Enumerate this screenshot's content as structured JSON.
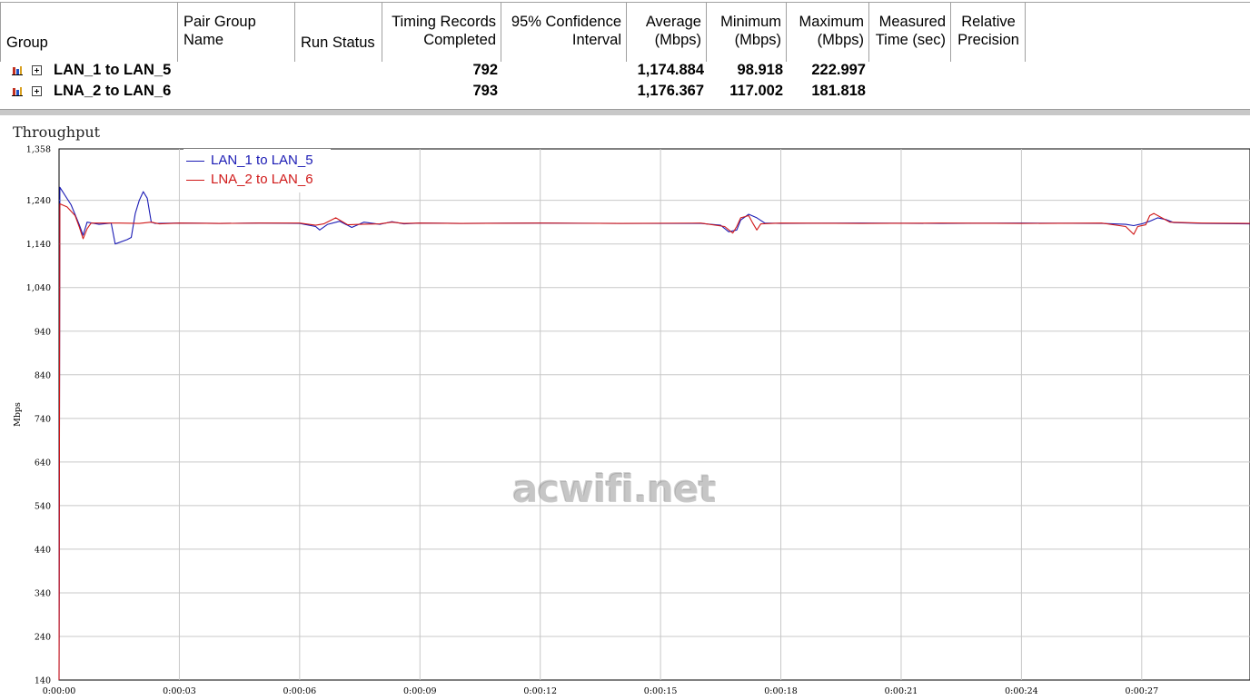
{
  "table": {
    "columns": [
      {
        "id": "group",
        "label_lines": [
          "Group"
        ]
      },
      {
        "id": "pair_group_name",
        "label_lines": [
          "Pair Group",
          "Name"
        ]
      },
      {
        "id": "run_status",
        "label_lines": [
          "Run Status"
        ]
      },
      {
        "id": "timing_records",
        "label_lines": [
          "Timing Records",
          "Completed"
        ]
      },
      {
        "id": "confidence",
        "label_lines": [
          "95% Confidence",
          "Interval"
        ]
      },
      {
        "id": "average",
        "label_lines": [
          "Average",
          "(Mbps)"
        ]
      },
      {
        "id": "minimum",
        "label_lines": [
          "Minimum",
          "(Mbps)"
        ]
      },
      {
        "id": "maximum",
        "label_lines": [
          "Maximum",
          "(Mbps)"
        ]
      },
      {
        "id": "measured_time",
        "label_lines": [
          "Measured",
          "Time (sec)"
        ]
      },
      {
        "id": "relative_precision",
        "label_lines": [
          "Relative",
          "Precision"
        ]
      }
    ],
    "rows": [
      {
        "group": "LAN_1 to LAN_5",
        "timing_records": "792",
        "average": "1,174.884",
        "minimum": "98.918",
        "maximum": "222.997"
      },
      {
        "group": "LNA_2 to LAN_6",
        "timing_records": "793",
        "average": "1,176.367",
        "minimum": "117.002",
        "maximum": "181.818"
      }
    ],
    "icons": {
      "row_icon": "bar-chart-icon",
      "expand_icon": "expand-plus-icon"
    }
  },
  "watermark": "acwifi.net",
  "chart_data": {
    "type": "line",
    "title": "Throughput",
    "ylabel": "Mbps",
    "xlabel": "",
    "ylim": [
      140,
      1358
    ],
    "xlim": [
      0,
      29.7
    ],
    "y_ticks": [
      140,
      240,
      340,
      440,
      540,
      640,
      740,
      840,
      940,
      1040,
      1140,
      1240,
      1358
    ],
    "y_tick_labels": [
      "140",
      "240",
      "340",
      "440",
      "540",
      "640",
      "740",
      "840",
      "940",
      "1,040",
      "1,140",
      "1,240",
      "1,358"
    ],
    "x_ticks": [
      0,
      3,
      6,
      9,
      12,
      15,
      18,
      21,
      24,
      27
    ],
    "x_tick_labels": [
      "0:00:00",
      "0:00:03",
      "0:00:06",
      "0:00:09",
      "0:00:12",
      "0:00:15",
      "0:00:18",
      "0:00:21",
      "0:00:24",
      "0:00:27"
    ],
    "grid": true,
    "legend_position": "top-left",
    "series": [
      {
        "name": "LAN_1 to LAN_5",
        "color": "#1a1ab4",
        "points": [
          [
            0,
            140
          ],
          [
            0.02,
            1270
          ],
          [
            0.3,
            1230
          ],
          [
            0.5,
            1185
          ],
          [
            0.6,
            1160
          ],
          [
            0.7,
            1190
          ],
          [
            1.0,
            1185
          ],
          [
            1.3,
            1188
          ],
          [
            1.4,
            1140
          ],
          [
            1.7,
            1150
          ],
          [
            1.8,
            1155
          ],
          [
            1.9,
            1210
          ],
          [
            2.0,
            1240
          ],
          [
            2.1,
            1260
          ],
          [
            2.2,
            1245
          ],
          [
            2.3,
            1190
          ],
          [
            2.4,
            1187
          ],
          [
            3.0,
            1188
          ],
          [
            4.0,
            1187
          ],
          [
            5.0,
            1188
          ],
          [
            6.0,
            1187
          ],
          [
            6.4,
            1180
          ],
          [
            6.5,
            1172
          ],
          [
            6.7,
            1185
          ],
          [
            7.0,
            1192
          ],
          [
            7.3,
            1178
          ],
          [
            7.6,
            1190
          ],
          [
            8.0,
            1185
          ],
          [
            8.3,
            1191
          ],
          [
            8.6,
            1186
          ],
          [
            9.0,
            1188
          ],
          [
            10.0,
            1187
          ],
          [
            12.0,
            1188
          ],
          [
            14.0,
            1187
          ],
          [
            16.0,
            1187
          ],
          [
            16.5,
            1183
          ],
          [
            16.7,
            1168
          ],
          [
            16.9,
            1172
          ],
          [
            17.0,
            1195
          ],
          [
            17.2,
            1208
          ],
          [
            17.4,
            1200
          ],
          [
            17.6,
            1188
          ],
          [
            18.0,
            1187
          ],
          [
            20.0,
            1188
          ],
          [
            22.0,
            1187
          ],
          [
            24.0,
            1188
          ],
          [
            26.0,
            1187
          ],
          [
            26.6,
            1185
          ],
          [
            26.8,
            1182
          ],
          [
            27.0,
            1186
          ],
          [
            27.2,
            1192
          ],
          [
            27.4,
            1200
          ],
          [
            27.6,
            1196
          ],
          [
            27.8,
            1189
          ],
          [
            28.5,
            1187
          ],
          [
            29.7,
            1186
          ]
        ]
      },
      {
        "name": "LNA_2 to LAN_6",
        "color": "#d01818",
        "points": [
          [
            0,
            140
          ],
          [
            0.02,
            1232
          ],
          [
            0.2,
            1225
          ],
          [
            0.4,
            1205
          ],
          [
            0.5,
            1180
          ],
          [
            0.6,
            1152
          ],
          [
            0.7,
            1175
          ],
          [
            0.8,
            1188
          ],
          [
            1.5,
            1188
          ],
          [
            2.0,
            1187
          ],
          [
            2.3,
            1190
          ],
          [
            2.5,
            1186
          ],
          [
            3.0,
            1188
          ],
          [
            4.0,
            1187
          ],
          [
            5.0,
            1188
          ],
          [
            6.0,
            1188
          ],
          [
            6.4,
            1183
          ],
          [
            6.6,
            1186
          ],
          [
            6.9,
            1200
          ],
          [
            7.2,
            1184
          ],
          [
            7.5,
            1185
          ],
          [
            8.0,
            1186
          ],
          [
            8.3,
            1190
          ],
          [
            8.6,
            1187
          ],
          [
            9.0,
            1188
          ],
          [
            10.0,
            1187
          ],
          [
            12.0,
            1188
          ],
          [
            14.0,
            1187
          ],
          [
            16.0,
            1188
          ],
          [
            16.6,
            1180
          ],
          [
            16.8,
            1165
          ],
          [
            16.9,
            1180
          ],
          [
            17.0,
            1200
          ],
          [
            17.2,
            1205
          ],
          [
            17.3,
            1188
          ],
          [
            17.4,
            1172
          ],
          [
            17.5,
            1186
          ],
          [
            18.0,
            1188
          ],
          [
            20.0,
            1187
          ],
          [
            22.0,
            1188
          ],
          [
            24.0,
            1187
          ],
          [
            26.0,
            1188
          ],
          [
            26.6,
            1180
          ],
          [
            26.8,
            1162
          ],
          [
            26.9,
            1180
          ],
          [
            27.1,
            1184
          ],
          [
            27.2,
            1205
          ],
          [
            27.3,
            1210
          ],
          [
            27.5,
            1200
          ],
          [
            27.7,
            1190
          ],
          [
            28.5,
            1188
          ],
          [
            29.7,
            1187
          ]
        ]
      }
    ]
  }
}
